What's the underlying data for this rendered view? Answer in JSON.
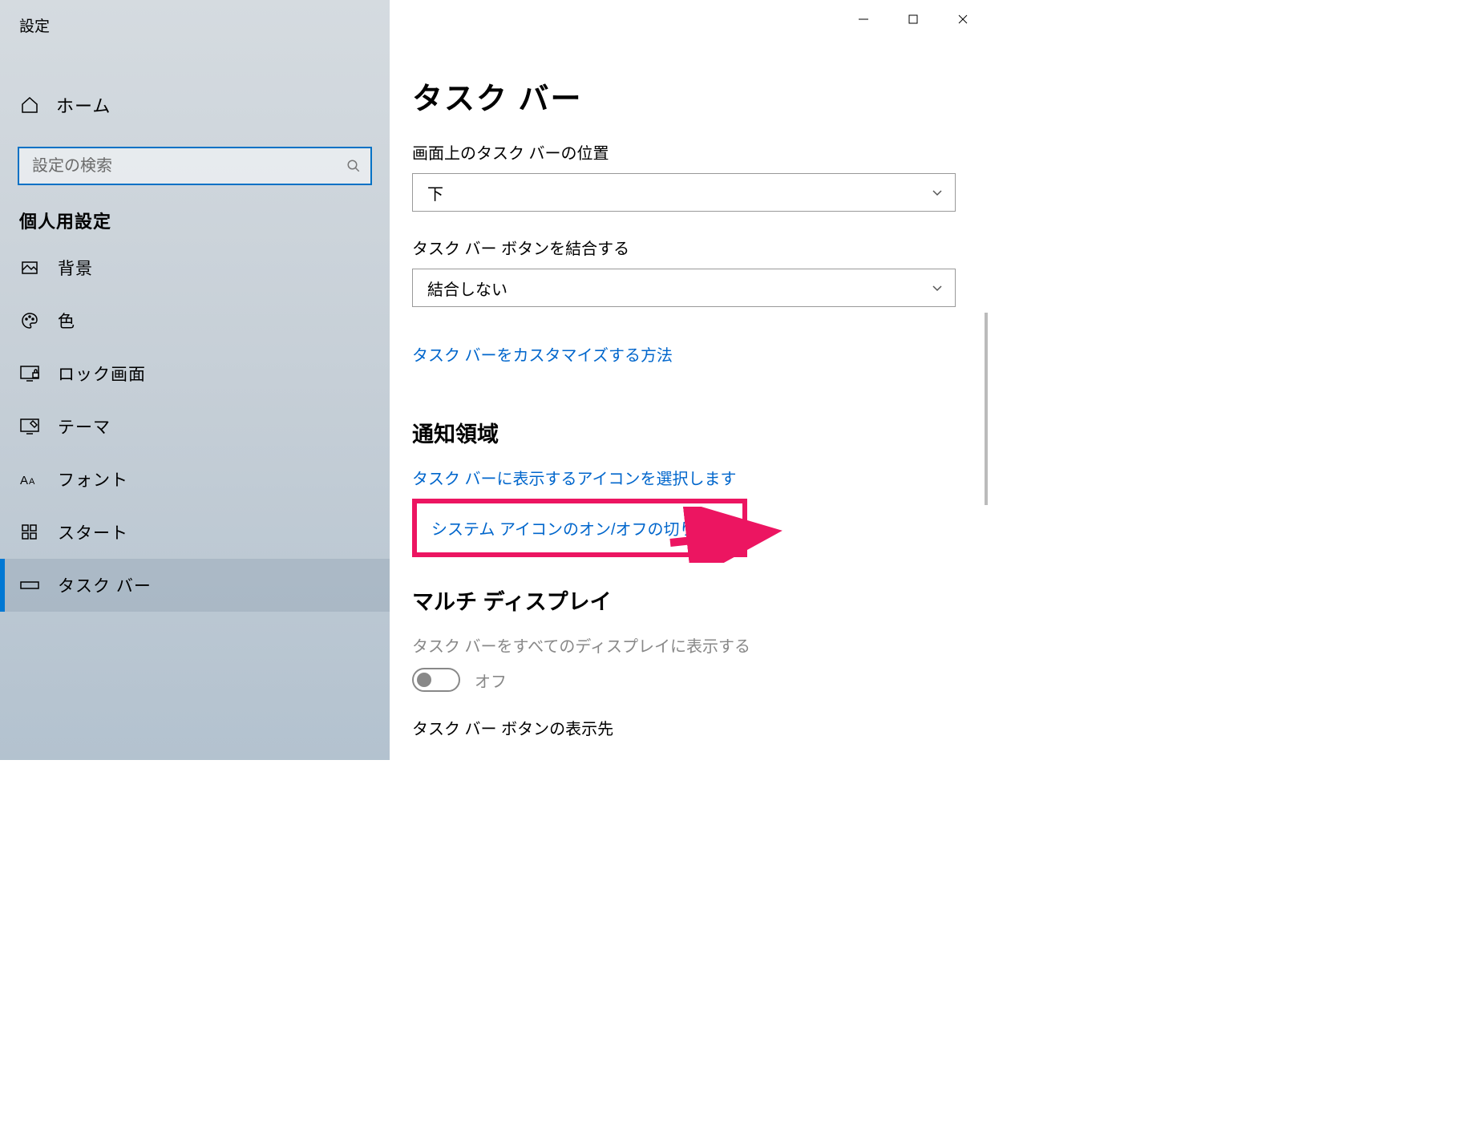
{
  "window_title": "設定",
  "home_label": "ホーム",
  "search_placeholder": "設定の検索",
  "section_header": "個人用設定",
  "nav": [
    {
      "label": "背景"
    },
    {
      "label": "色"
    },
    {
      "label": "ロック画面"
    },
    {
      "label": "テーマ"
    },
    {
      "label": "フォント"
    },
    {
      "label": "スタート"
    },
    {
      "label": "タスク バー"
    }
  ],
  "page_title": "タスク バー",
  "position_label": "画面上のタスク バーの位置",
  "position_value": "下",
  "combine_label": "タスク バー ボタンを結合する",
  "combine_value": "結合しない",
  "customize_link": "タスク バーをカスタマイズする方法",
  "notification_heading": "通知領域",
  "select_icons_link": "タスク バーに表示するアイコンを選択します",
  "system_icons_link": "システム アイコンのオン/オフの切り替え",
  "multi_display_heading": "マルチ ディスプレイ",
  "multi_display_label": "タスク バーをすべてのディスプレイに表示する",
  "toggle_state": "オフ",
  "bottom_label": "タスク バー ボタンの表示先"
}
